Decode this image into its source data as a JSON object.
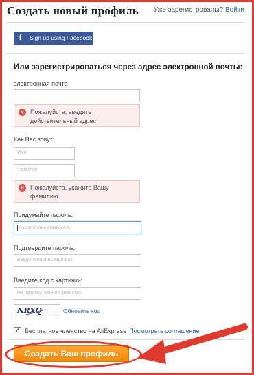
{
  "header": {
    "title": "Создать новый профиль",
    "already_registered": "Уже зарегистрованы?",
    "login_link": "Войти"
  },
  "facebook": {
    "icon": "f",
    "label": "Sign up using Facebook"
  },
  "form": {
    "section_title": "Или зарегистрироваться через адрес электронной почты:",
    "email_label": "электронная почта",
    "email_value": "",
    "email_error": "Пожалуйста, введите действительный адрес",
    "name_label": "Как Вас зовут:",
    "first_name_placeholder": "Имя",
    "last_name_placeholder": "Фамилия",
    "name_error": "Пожалуйста, укажите Вашу фамилию",
    "password_label": "Придумайте пароль:",
    "password_placeholder": "6 или более символов",
    "confirm_label": "Подтвердите пароль:",
    "confirm_placeholder": "Введите пароль ещё раз",
    "captcha_label": "Введите код с картинки:",
    "captcha_placeholder": "Не чувствительно к регистру",
    "captcha_image_text": "NRXQ",
    "refresh_link": "Обновить код",
    "membership_text": "Бесплатное членство на AliExpress",
    "membership_link": "Посмотреть соглашение",
    "membership_checked": true,
    "submit_label": "Создать Ваш профиль"
  },
  "colors": {
    "highlight": "#e03a2f",
    "facebook": "#3b5998",
    "submit": "#f59a1e",
    "link": "#2a6ebb",
    "error_bg": "#fdeeee"
  }
}
